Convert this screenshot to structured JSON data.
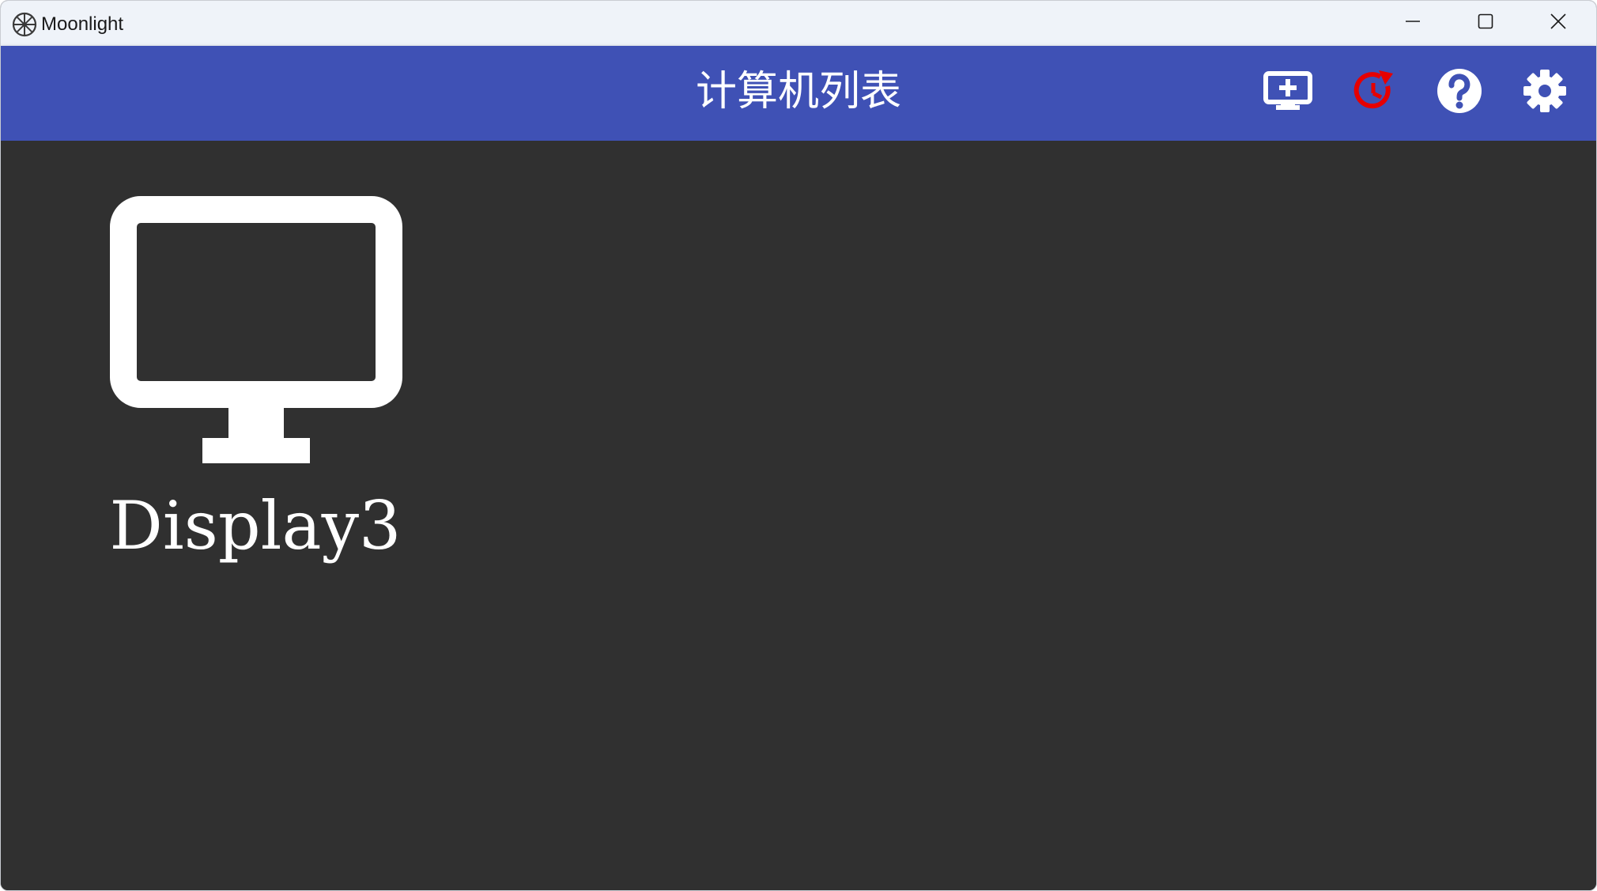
{
  "window": {
    "app_title": "Moonlight",
    "icons": {
      "app": "moonlight-logo-icon",
      "minimize": "minimize-icon",
      "maximize": "maximize-icon",
      "close": "close-icon"
    }
  },
  "header": {
    "title": "计算机列表",
    "background": "#3f51b5",
    "buttons": [
      {
        "icon": "add-pc-icon"
      },
      {
        "icon": "refresh-icon",
        "color": "#e60000"
      },
      {
        "icon": "help-icon"
      },
      {
        "icon": "settings-icon"
      }
    ]
  },
  "main": {
    "background": "#303030",
    "computers": [
      {
        "name": "Display3",
        "icon": "monitor-icon"
      }
    ]
  }
}
